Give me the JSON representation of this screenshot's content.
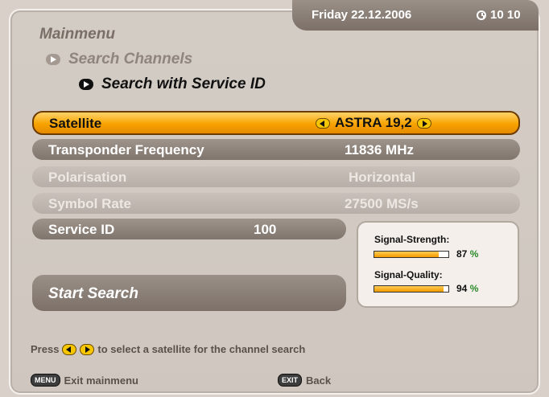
{
  "header": {
    "date": "Friday 22.12.2006",
    "time": "10 10",
    "title": "Mainmenu",
    "breadcrumb_1": "Search Channels",
    "breadcrumb_2": "Search with Service ID"
  },
  "menu": {
    "satellite": {
      "label": "Satellite",
      "value": "ASTRA 19,2"
    },
    "transponder": {
      "label": "Transponder Frequency",
      "value": "11836 MHz"
    },
    "polarisation": {
      "label": "Polarisation",
      "value": "Horizontal"
    },
    "symbol_rate": {
      "label": "Symbol Rate",
      "value": "27500 MS/s"
    },
    "service_id": {
      "label": "Service ID",
      "value": "100"
    },
    "start_search": {
      "label": "Start Search"
    }
  },
  "signal": {
    "strength_label": "Signal-Strength:",
    "strength_value": "87",
    "strength_fraction": 0.87,
    "quality_label": "Signal-Quality:",
    "quality_value": "94",
    "quality_fraction": 0.94,
    "percent_sign": "%"
  },
  "help": {
    "press": "Press",
    "text": "to select a satellite for the channel search"
  },
  "footer": {
    "menu_key": "MENU",
    "exit_mainmenu": "Exit mainmenu",
    "exit_key": "EXIT",
    "back": "Back"
  },
  "colors": {
    "accent_orange": "#f7a300",
    "panel": "#d3ccc5",
    "row_dark": "#8c8279",
    "signal_green": "#2b8a2b"
  }
}
